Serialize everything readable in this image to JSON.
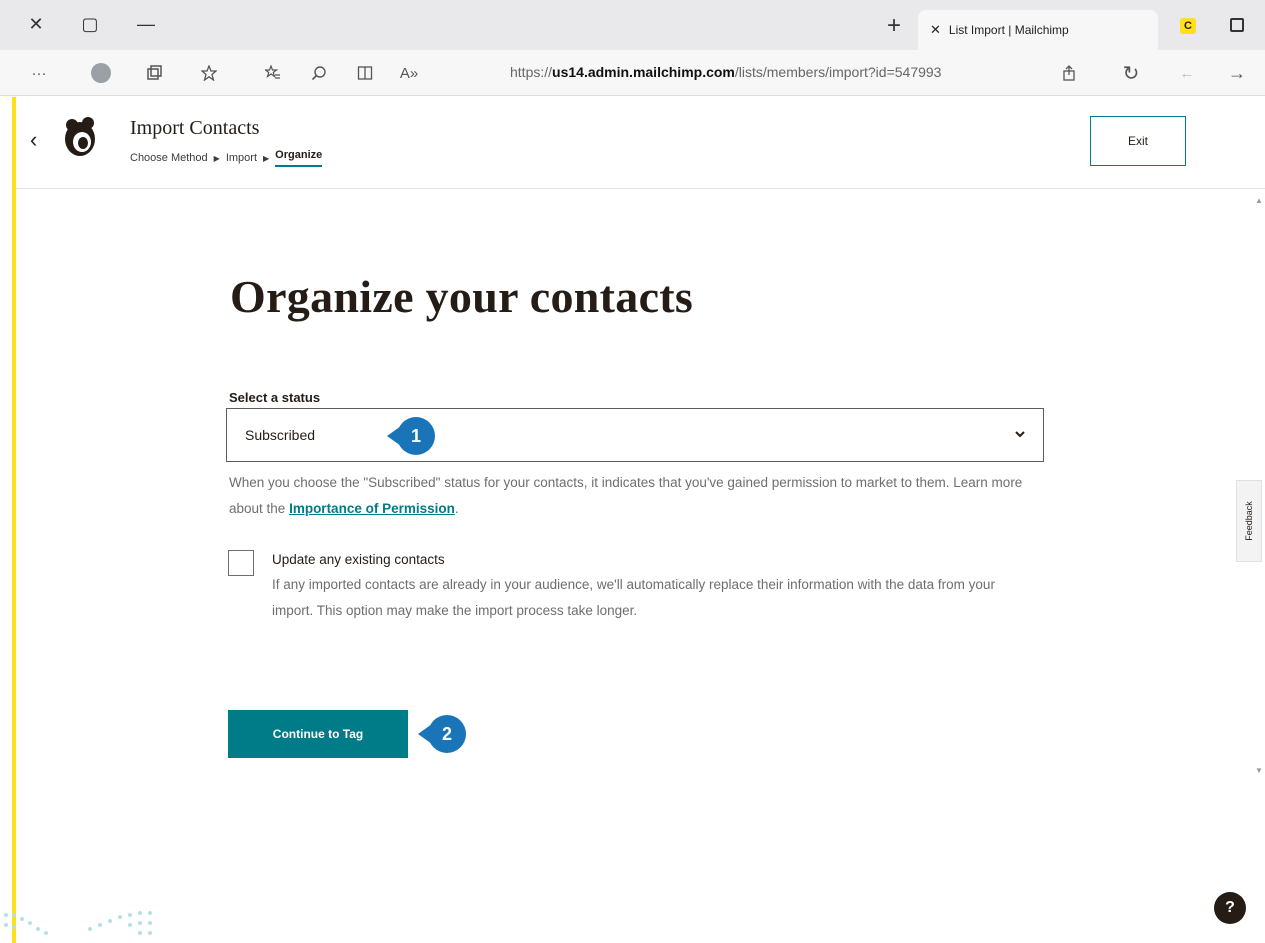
{
  "browser": {
    "tab_title": "List Import | Mailchimp",
    "url_prefix": "https://",
    "url_host": "us14.admin.mailchimp.com",
    "url_path": "/lists/members/import?id=547993",
    "new_tab_glyph": "+",
    "close_tab_glyph": "✕",
    "window_close_glyph": "✕",
    "window_restore_glyph": "▢",
    "window_min_glyph": "—",
    "more_glyph": "···",
    "refresh_glyph": "↻",
    "back_glyph": "←",
    "forward_glyph": "→",
    "read_aloud_glyph": "A»",
    "icons": [
      "close-icon",
      "restore-icon",
      "minimize-icon",
      "new-tab-icon",
      "more-icon",
      "profile-icon",
      "collections-icon",
      "favorites-icon",
      "favorites-bar-icon",
      "find-icon",
      "reader-icon",
      "read-aloud-icon",
      "share-icon",
      "refresh-icon",
      "back-icon",
      "forward-icon"
    ]
  },
  "header": {
    "title": "Import Contacts",
    "breadcrumb": [
      "Choose Method",
      "Import",
      "Organize"
    ],
    "back_glyph": "‹",
    "exit_label": "Exit"
  },
  "main": {
    "heading": "Organize your contacts",
    "status_label": "Select a status",
    "status_value": "Subscribed",
    "help_text_before": "When you choose the \"Subscribed\" status for your contacts, it indicates that you've gained permission to market to them. Learn more about the ",
    "help_link": "Importance of Permission",
    "help_text_after": ".",
    "checkbox_title": "Update any existing contacts",
    "checkbox_desc": "If any imported contacts are already in your audience, we'll automatically replace their information with the data from your import. This option may make the import process take longer.",
    "checkbox_checked": false,
    "continue_label": "Continue to Tag"
  },
  "callouts": [
    "1",
    "2"
  ],
  "sidebar": {
    "feedback_label": "Feedback"
  },
  "help_button": "?",
  "colors": {
    "accent": "#007c89",
    "brand_yellow": "#ffe01b",
    "callout_blue": "#1a75b8",
    "text": "#241c15"
  }
}
